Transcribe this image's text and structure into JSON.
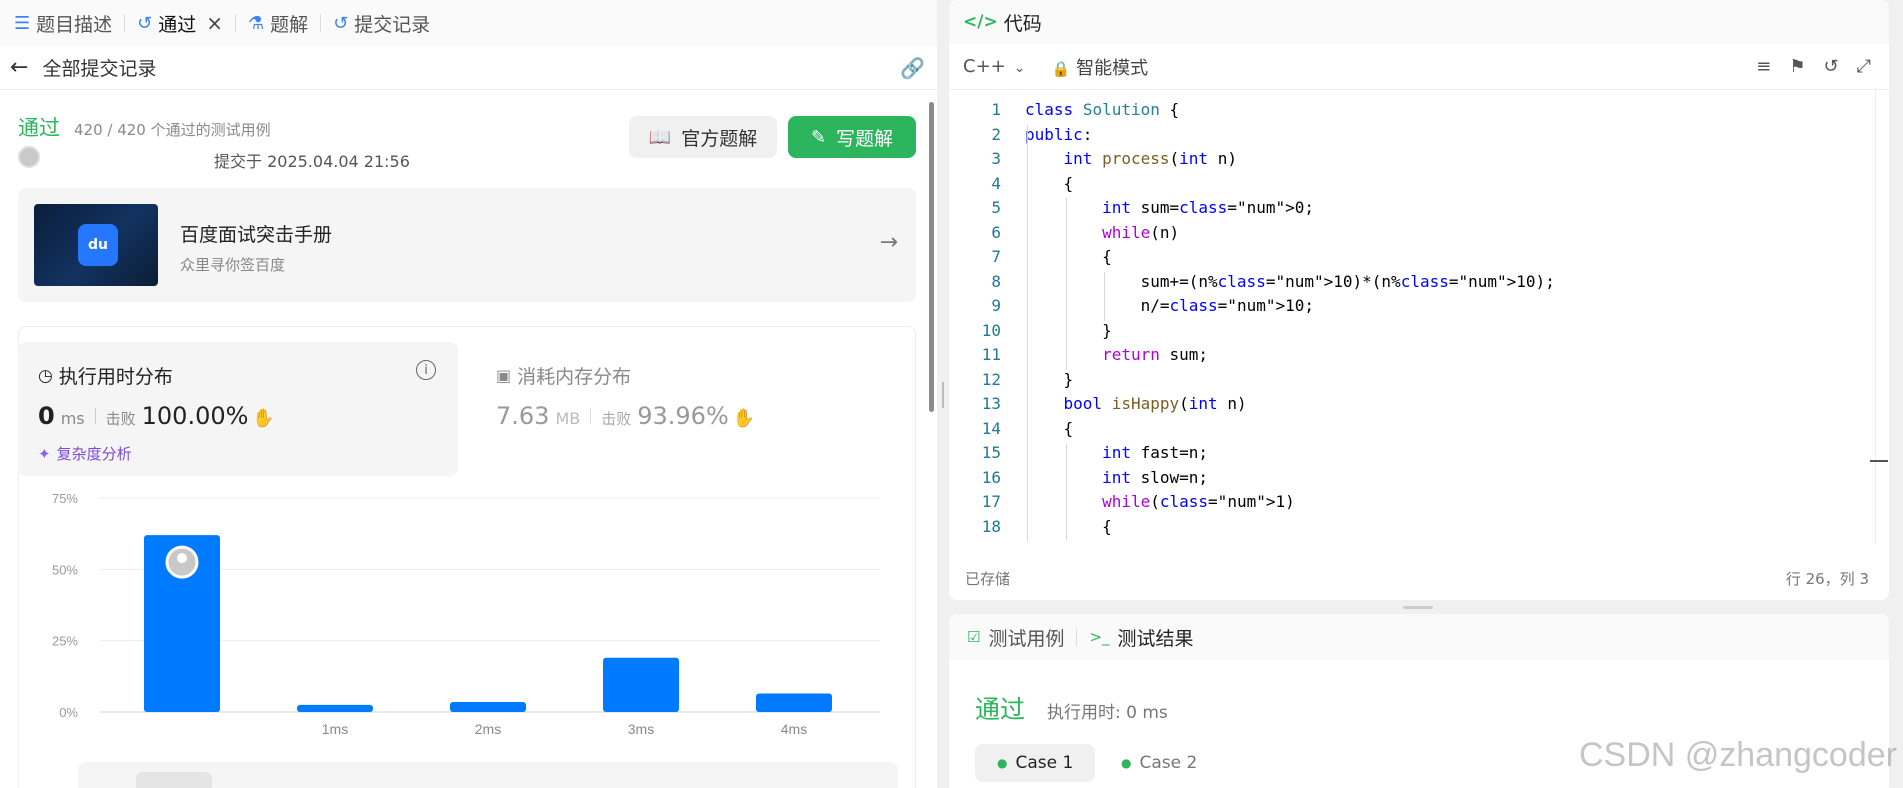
{
  "tabs": [
    {
      "label": "题目描述",
      "icon": "document-icon"
    },
    {
      "label": "通过",
      "icon": "history-icon",
      "active": true
    },
    {
      "label": "题解",
      "icon": "flask-icon"
    },
    {
      "label": "提交记录",
      "icon": "history-icon"
    }
  ],
  "subheader": {
    "title": "全部提交记录"
  },
  "submission": {
    "status": "通过",
    "cases": "420 / 420 个通过的测试用例",
    "submitted": "提交于 2025.04.04 21:56",
    "official_solution": "官方题解",
    "write_solution": "写题解"
  },
  "ad": {
    "title": "百度面试突击手册",
    "subtitle": "众里寻你签百度",
    "logo": "du"
  },
  "runtime": {
    "title": "执行用时分布",
    "value": "0",
    "unit": "ms",
    "beat_label": "击败",
    "beat": "100.00%",
    "complexity": "复杂度分析"
  },
  "memory": {
    "title": "消耗内存分布",
    "value": "7.63",
    "unit": "MB",
    "beat_label": "击败",
    "beat": "93.96%"
  },
  "chart_data": {
    "type": "bar",
    "categories": [
      "",
      "1ms",
      "2ms",
      "3ms",
      "4ms"
    ],
    "values": [
      62,
      2.5,
      3.5,
      19,
      6.5
    ],
    "yticks": [
      "0%",
      "25%",
      "50%",
      "75%"
    ],
    "ylim": [
      0,
      75
    ],
    "grid": true,
    "bar_color": "#007aff",
    "highlight_index": 0
  },
  "code": {
    "header": "代码",
    "language": "C++",
    "mode": "智能模式",
    "saved": "已存储",
    "cursor": "行 26，列 3",
    "lines": [
      "class Solution {",
      "public:",
      "    int process(int n)",
      "    {",
      "        int sum=0;",
      "        while(n)",
      "        {",
      "            sum+=(n%10)*(n%10);",
      "            n/=10;",
      "        }",
      "        return sum;",
      "    }",
      "    bool isHappy(int n)",
      "    {",
      "        int fast=n;",
      "        int slow=n;",
      "        while(1)",
      "        {"
    ]
  },
  "test": {
    "tab_cases": "测试用例",
    "tab_result": "测试结果",
    "status": "通过",
    "runtime": "执行用时: 0 ms",
    "cases": [
      "Case 1",
      "Case 2"
    ]
  },
  "watermark": "CSDN @zhangcoder",
  "colors": {
    "accent_green": "#2db55d",
    "bar_blue": "#007aff",
    "complexity_purple": "#7b4bd6"
  }
}
